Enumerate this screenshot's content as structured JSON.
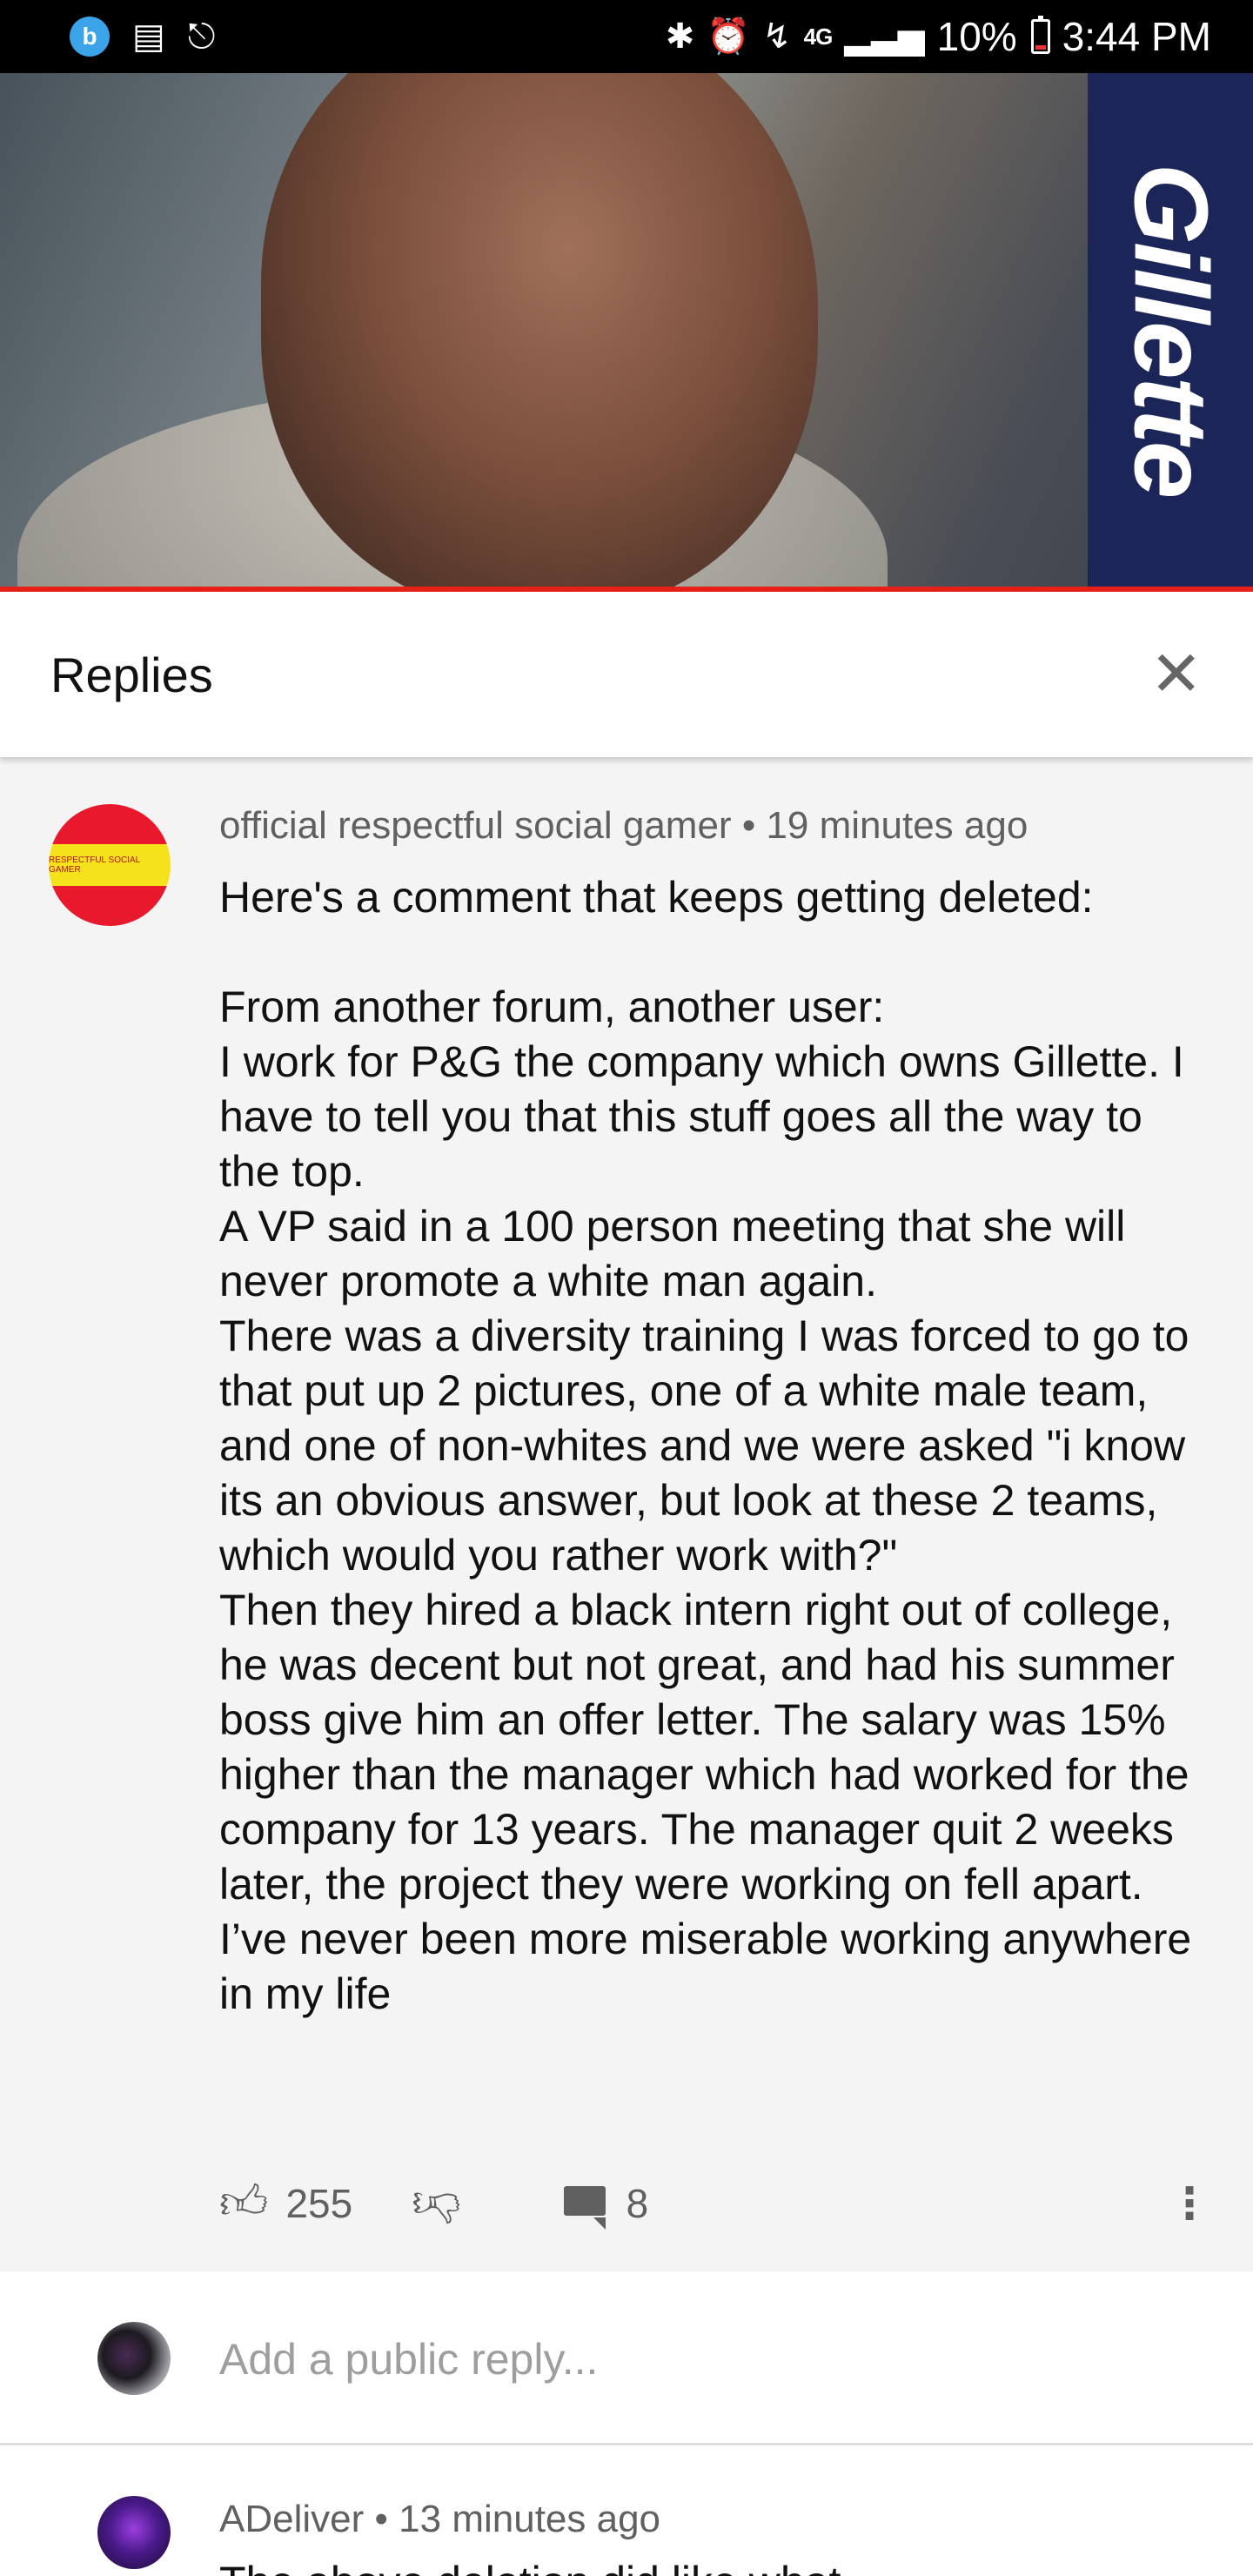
{
  "status_bar": {
    "battery": "10%",
    "time": "3:44 PM",
    "network": "4G",
    "icons": [
      "bixby-app-icon",
      "message-icon",
      "headset-icon",
      "bluetooth-icon",
      "alarm-icon",
      "charging-icon",
      "signal-icon",
      "battery-icon"
    ]
  },
  "video": {
    "brand": "Gillette",
    "progress_color": "#e62117"
  },
  "replies_panel": {
    "title": "Replies",
    "close_icon": "close-icon"
  },
  "comment": {
    "author": "official respectful social gamer",
    "separator": "•",
    "time": "19 minutes ago",
    "avatar_text": "RESPECTFUL SOCIAL GAMER",
    "body": "Here's a comment that keeps getting deleted:\n\nFrom another forum, another user:\nI work for P&G the company which owns Gillette. I have to tell you that this stuff goes all the way to the top.\nA VP said in a 100 person meeting that she will never promote a white man again.\nThere was a diversity training I was forced to go to that put up 2 pictures, one of a white male team, and one of non-whites and we were asked \"i know its an obvious answer, but look at these 2 teams, which would you rather work with?\"\nThen they hired a black intern right out of college, he was decent but not great, and had his summer boss give him an offer letter. The salary was 15% higher than the manager which had worked for the company for 13 years. The manager quit 2 weeks later, the project they were working on fell apart.\nI’ve never been more miserable working anywhere in my life",
    "likes": "255",
    "replies": "8"
  },
  "add_reply": {
    "placeholder": "Add a public reply..."
  },
  "next_comment": {
    "author": "ADeliver",
    "separator": "•",
    "time": "13 minutes ago",
    "text": "The above deletion did like what"
  }
}
